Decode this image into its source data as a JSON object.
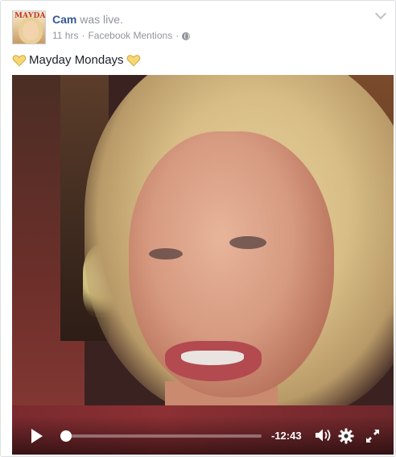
{
  "post": {
    "author": "Cam",
    "action": " was live.",
    "time": "11 hrs",
    "separator": " · ",
    "source": "Facebook Mentions",
    "dot": " ·",
    "message": "Mayday Mondays",
    "avatar_logo_text": "MAYDAY"
  },
  "player": {
    "remaining_time": "-12:43",
    "progress_fraction": 0.0
  },
  "icons": {
    "privacy": "globe-icon",
    "options": "chevron-down-icon",
    "emoji": "yellow-heart-icon",
    "play": "play-icon",
    "volume": "volume-icon",
    "settings": "gear-icon",
    "fullscreen": "fullscreen-icon"
  },
  "colors": {
    "author_link": "#365899",
    "meta_text": "#90949c",
    "heart": "#f7d774"
  }
}
